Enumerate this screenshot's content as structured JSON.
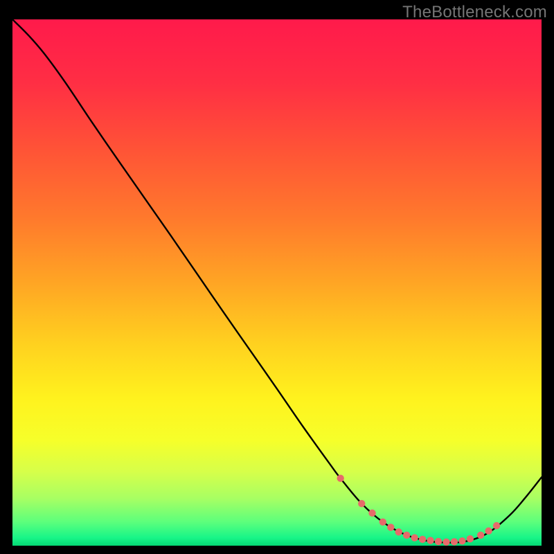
{
  "watermark": "TheBottleneck.com",
  "chart_data": {
    "type": "line",
    "title": "",
    "xlabel": "",
    "ylabel": "",
    "xlim": [
      0,
      100
    ],
    "ylim": [
      0,
      100
    ],
    "grid": false,
    "legend": false,
    "series": [
      {
        "name": "curve",
        "x": [
          0,
          3,
          6,
          10,
          15,
          20,
          25,
          30,
          35,
          40,
          45,
          50,
          55,
          60,
          62,
          66,
          70,
          74,
          78,
          82,
          86,
          90,
          94,
          97,
          100
        ],
        "y": [
          100,
          97,
          93.5,
          88,
          80.5,
          73.2,
          66,
          58.8,
          51.5,
          44.2,
          37,
          29.8,
          22.5,
          15.5,
          12.8,
          8,
          4.5,
          2.2,
          1,
          0.6,
          0.9,
          2.5,
          5.8,
          9.2,
          13
        ]
      }
    ],
    "highlight_points": {
      "name": "dots",
      "color": "#e66a6a",
      "radius": 5.2,
      "x": [
        62,
        66,
        68,
        70,
        71.5,
        73,
        74.5,
        76,
        77.5,
        79,
        80.5,
        82,
        83.5,
        85,
        86.5,
        88.5,
        90,
        91.5
      ],
      "y": [
        12.8,
        8,
        6.2,
        4.5,
        3.5,
        2.6,
        2,
        1.5,
        1.2,
        1,
        0.8,
        0.7,
        0.75,
        0.9,
        1.3,
        2.0,
        2.8,
        3.8
      ]
    },
    "gradient_stops": [
      {
        "offset": 0.0,
        "color": "#ff1a4b"
      },
      {
        "offset": 0.12,
        "color": "#ff2e44"
      },
      {
        "offset": 0.25,
        "color": "#ff5436"
      },
      {
        "offset": 0.38,
        "color": "#ff7a2c"
      },
      {
        "offset": 0.5,
        "color": "#ffa524"
      },
      {
        "offset": 0.62,
        "color": "#ffd21f"
      },
      {
        "offset": 0.72,
        "color": "#fff21e"
      },
      {
        "offset": 0.8,
        "color": "#f6ff2a"
      },
      {
        "offset": 0.86,
        "color": "#d6ff4a"
      },
      {
        "offset": 0.91,
        "color": "#a8ff63"
      },
      {
        "offset": 0.955,
        "color": "#5cff7c"
      },
      {
        "offset": 0.985,
        "color": "#18f588"
      },
      {
        "offset": 1.0,
        "color": "#05d874"
      }
    ]
  }
}
